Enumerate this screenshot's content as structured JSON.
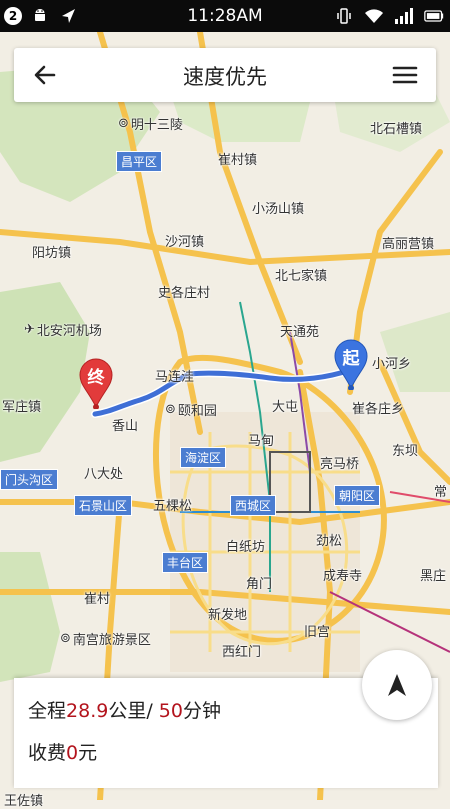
{
  "status_bar": {
    "notification_count": "2",
    "time": "11:28AM"
  },
  "header": {
    "title": "速度优先"
  },
  "map": {
    "labels": {
      "ming13": "明十三陵",
      "changping": "昌平区",
      "cuicun": "崔村镇",
      "beiqicao": "北石槽镇",
      "xiaotangshan": "小汤山镇",
      "shahe": "沙河镇",
      "gaoliying": "高丽营镇",
      "yangfang": "阳坊镇",
      "beiqijia": "北七家镇",
      "shigezhuang": "史各庄村",
      "beianhe": "北安河机场",
      "tiantongyuan": "天通苑",
      "xiaotangxiang": "小河乡",
      "majiapu": "马连洼",
      "yiheyuan": "颐和园",
      "dutun": "大屯",
      "cuigezhuang": "崔各庄乡",
      "junzhuang": "军庄镇",
      "xiangshan": "香山",
      "madian": "马甸",
      "dongba": "东坝",
      "haidian": "海淀区",
      "liangmaqiao": "亮马桥",
      "mentougou": "门头沟区",
      "badachu": "八大处",
      "chaoyang": "朝阳区",
      "shijingshan": "石景山区",
      "wukesong": "五棵松",
      "xicheng": "西城区",
      "chang": "常",
      "baizhifang": "白纸坊",
      "jinsong": "劲松",
      "fengtai": "丰台区",
      "jiaomen": "角门",
      "chengshousi": "成寿寺",
      "heizhuang": "黑庄",
      "hucun": "崔村",
      "xinfadi": "新发地",
      "nangong": "南宫旅游景区",
      "jiugong": "旧宫",
      "xihongmen": "西红门",
      "bottom": "王佐镇"
    },
    "start_marker": "起",
    "end_marker": "终",
    "route_color": "#3f6fd6"
  },
  "summary": {
    "distance_prefix": "全程",
    "distance_value": "28.9",
    "distance_unit": "公里/",
    "duration_value": "50",
    "duration_unit": "分钟",
    "toll_label": "收费",
    "toll_value": "0",
    "toll_unit": "元"
  }
}
